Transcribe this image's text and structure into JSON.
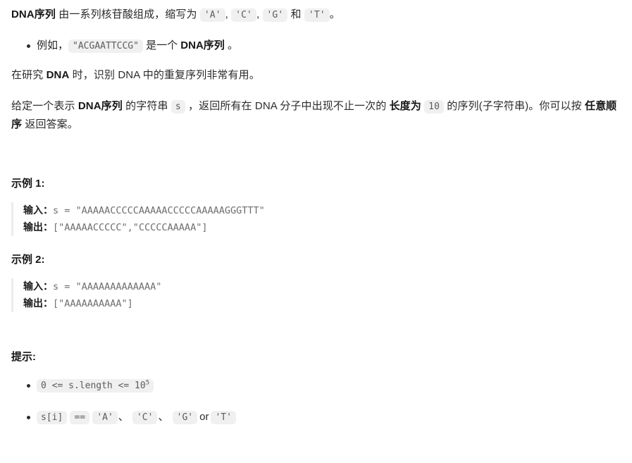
{
  "intro": {
    "term": "DNA序列",
    "text_after_term": " 由一系列核苷酸组成，缩写为 ",
    "code_a": "'A'",
    "sep1": ", ",
    "code_c": "'C'",
    "sep2": ", ",
    "code_g": "'G'",
    "sep3": " 和 ",
    "code_t": "'T'",
    "tail": "。"
  },
  "example_bullet": {
    "prefix": "例如，",
    "code": "\"ACGAATTCCG\"",
    "middle": " 是一个 ",
    "term": "DNA序列",
    "tail": " 。"
  },
  "study_para": {
    "part1": "在研究 ",
    "bold_dna": "DNA",
    "part2": " 时，识别 DNA 中的重复序列非常有用。"
  },
  "task_para": {
    "p1": "给定一个表示 ",
    "bold1": "DNA序列",
    "p2": " 的字符串 ",
    "code_s": "s",
    "p3": " ，返回所有在 DNA 分子中出现不止一次的 ",
    "bold2": "长度为",
    "code_len": "10",
    "p4": " 的序列(子字符串)。你可以按 ",
    "bold3": "任意顺序",
    "p5": " 返回答案。"
  },
  "examples": [
    {
      "heading": "示例 1:",
      "input_label": "输入：",
      "input_value": "s = \"AAAAACCCCCAAAAACCCCCAAAAAGGGTTT\"",
      "output_label": "输出：",
      "output_value": "[\"AAAAACCCCC\",\"CCCCCAAAAA\"]"
    },
    {
      "heading": "示例 2:",
      "input_label": "输入：",
      "input_value": "s = \"AAAAAAAAAAAAA\"",
      "output_label": "输出：",
      "output_value": "[\"AAAAAAAAAA\"]"
    }
  ],
  "hints": {
    "heading": "提示:",
    "items": [
      {
        "code_before_sup": "0 <= s.length <= 10",
        "sup": "5"
      },
      {
        "code_si": "s[i]",
        "code_eq": "==",
        "code_a": "'A'",
        "sep1": "、",
        "code_c": "'C'",
        "sep2": "、",
        "code_g": "'G'",
        "or": "or",
        "code_t": "'T'"
      }
    ]
  },
  "colors": {
    "text": "#262626",
    "code_bg": "#f0f0f0",
    "code_text": "#5c5c5c",
    "quote_border": "#ececec"
  }
}
